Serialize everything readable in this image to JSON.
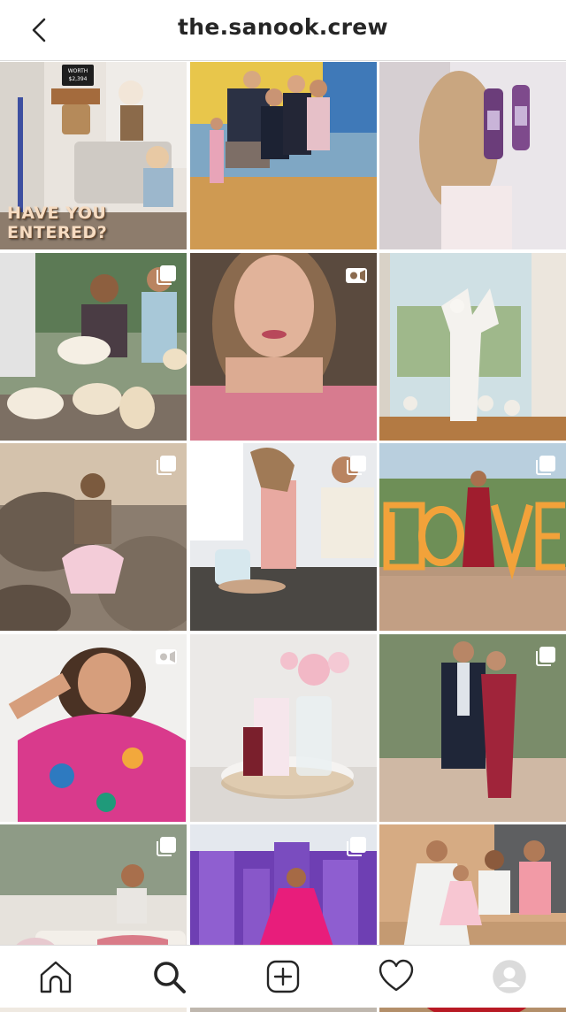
{
  "header": {
    "username": "the.sanook.crew",
    "back_icon": "chevron-left-icon"
  },
  "grid": {
    "posts": [
      {
        "type": "image",
        "overlay_text": "HAVE YOU ENTERED?",
        "sign_text": "WORTH $2,394"
      },
      {
        "type": "image"
      },
      {
        "type": "image"
      },
      {
        "type": "carousel",
        "badge_icon": "carousel-icon"
      },
      {
        "type": "video",
        "badge_icon": "video-icon"
      },
      {
        "type": "image"
      },
      {
        "type": "carousel",
        "badge_icon": "carousel-icon"
      },
      {
        "type": "carousel",
        "badge_icon": "carousel-icon"
      },
      {
        "type": "carousel",
        "badge_icon": "carousel-icon"
      },
      {
        "type": "video",
        "badge_icon": "video-icon"
      },
      {
        "type": "image"
      },
      {
        "type": "carousel",
        "badge_icon": "carousel-icon"
      },
      {
        "type": "carousel",
        "badge_icon": "carousel-icon"
      },
      {
        "type": "carousel",
        "badge_icon": "carousel-icon"
      },
      {
        "type": "image"
      }
    ]
  },
  "bottom_nav": {
    "items": [
      {
        "icon": "home-icon"
      },
      {
        "icon": "search-icon",
        "active": true
      },
      {
        "icon": "new-post-icon"
      },
      {
        "icon": "heart-icon"
      },
      {
        "icon": "profile-avatar-icon"
      }
    ]
  },
  "colors": {
    "text": "#262626",
    "border": "#dbdbdb",
    "background": "#ffffff"
  }
}
